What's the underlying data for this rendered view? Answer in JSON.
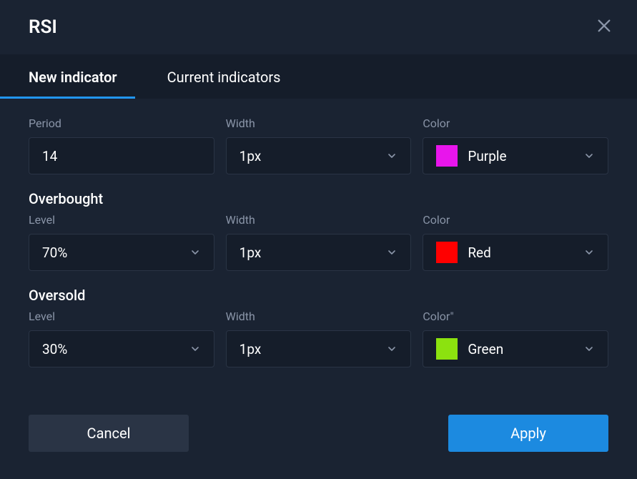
{
  "header": {
    "title": "RSI"
  },
  "tabs": {
    "new_indicator": "New indicator",
    "current_indicators": "Current indicators"
  },
  "main": {
    "period_label": "Period",
    "period_value": "14",
    "width_label": "Width",
    "width_value": "1px",
    "color_label": "Color",
    "color_value": "Purple",
    "color_swatch": "#e815ec"
  },
  "overbought": {
    "section_title": "Overbought",
    "level_label": "Level",
    "level_value": "70%",
    "width_label": "Width",
    "width_value": "1px",
    "color_label": "Color",
    "color_value": "Red",
    "color_swatch": "#ff0000"
  },
  "oversold": {
    "section_title": "Oversold",
    "level_label": "Level",
    "level_value": "30%",
    "width_label": "Width",
    "width_value": "1px",
    "color_label": "Color\"",
    "color_value": "Green",
    "color_swatch": "#8ce20f"
  },
  "footer": {
    "cancel": "Cancel",
    "apply": "Apply"
  }
}
